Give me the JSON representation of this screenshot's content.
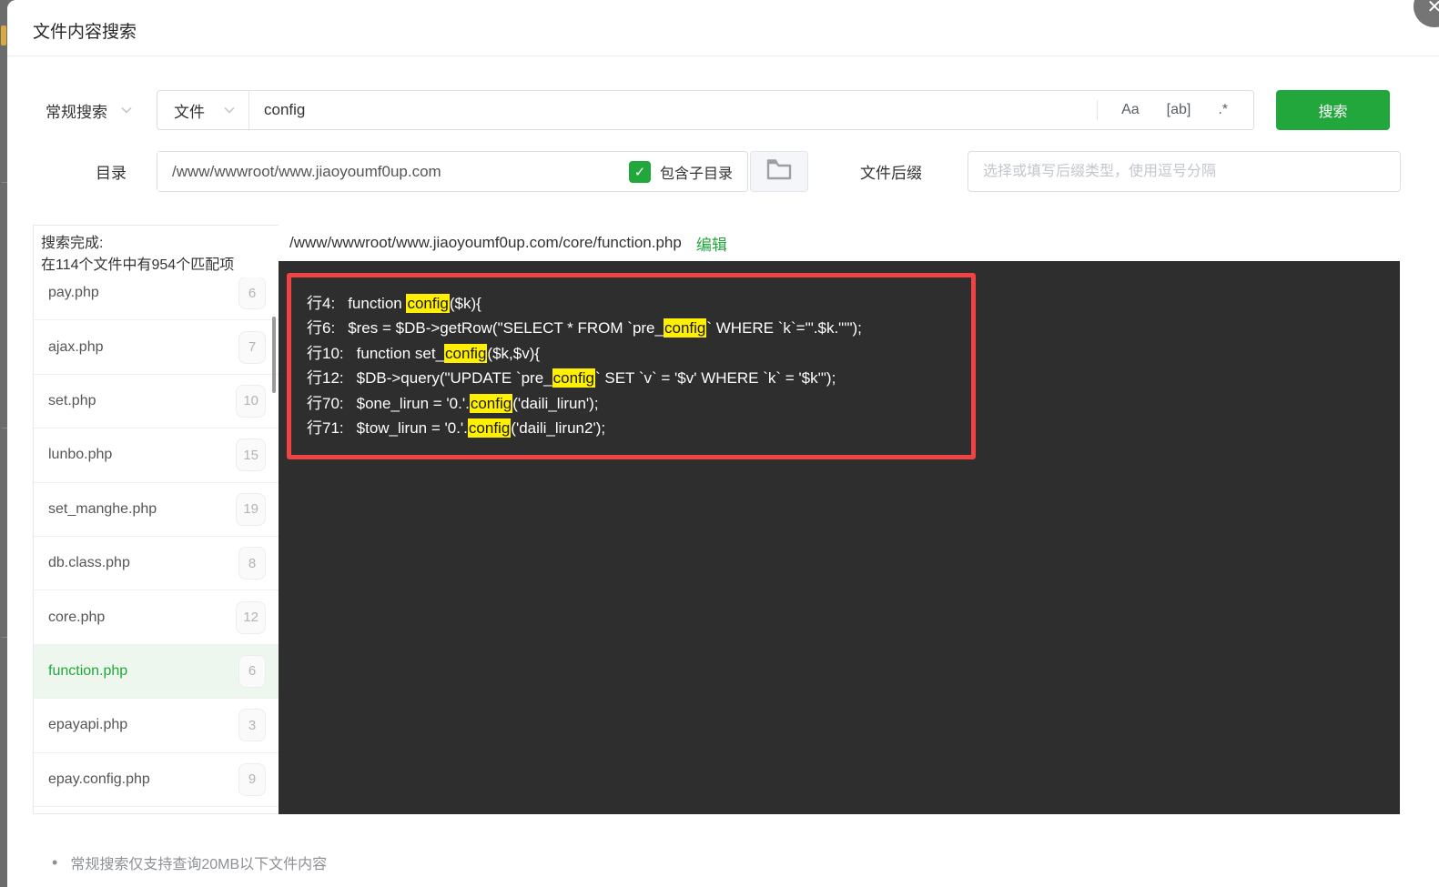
{
  "title": "文件内容搜索",
  "icons": {
    "close": "✕",
    "check": "✓",
    "bullet": "•",
    "chevron": "chevron-down",
    "folder": "folder-outline"
  },
  "colors": {
    "green": "#21a73c",
    "highlight_yellow": "#ffef00",
    "annotation_red": "#f04343",
    "code_bg": "#2e2e2e"
  },
  "search_bar": {
    "mode_select": "常规搜索",
    "type_select": "文件",
    "keyword": "config",
    "case_option": "Aa",
    "word_option": "[ab]",
    "regex_option": ".*",
    "search_button": "搜索"
  },
  "path_bar": {
    "dir_label": "目录",
    "dir_value": "/www/wwwroot/www.jiaoyoumf0up.com",
    "include_sub_label": "包含子目录",
    "suffix_label": "文件后缀",
    "suffix_placeholder": "选择或填写后缀类型，使用逗号分隔"
  },
  "results": {
    "summary_line1": "搜索完成:",
    "summary_line2": "在114个文件中有954个匹配项",
    "files": [
      {
        "name": "pay.php",
        "count": "6",
        "active": false
      },
      {
        "name": "ajax.php",
        "count": "7",
        "active": false
      },
      {
        "name": "set.php",
        "count": "10",
        "active": false
      },
      {
        "name": "lunbo.php",
        "count": "15",
        "active": false
      },
      {
        "name": "set_manghe.php",
        "count": "19",
        "active": false
      },
      {
        "name": "db.class.php",
        "count": "8",
        "active": false
      },
      {
        "name": "core.php",
        "count": "12",
        "active": false
      },
      {
        "name": "function.php",
        "count": "6",
        "active": true
      },
      {
        "name": "epayapi.php",
        "count": "3",
        "active": false
      },
      {
        "name": "epay.config.php",
        "count": "9",
        "active": false
      }
    ]
  },
  "viewer": {
    "path": "/www/wwwroot/www.jiaoyoumf0up.com/core/function.php",
    "edit_link": "编辑",
    "lines": [
      {
        "num": "行4:",
        "parts": [
          {
            "t": "function ",
            "h": false
          },
          {
            "t": "config",
            "h": true
          },
          {
            "t": "($k){",
            "h": false
          }
        ]
      },
      {
        "num": "行6:",
        "parts": [
          {
            "t": "$res = $DB->getRow(\"SELECT * FROM `pre_",
            "h": false
          },
          {
            "t": "config",
            "h": true
          },
          {
            "t": "` WHERE `k`='\".$k.\"'\");",
            "h": false
          }
        ]
      },
      {
        "num": "行10:",
        "parts": [
          {
            "t": "function set_",
            "h": false
          },
          {
            "t": "config",
            "h": true
          },
          {
            "t": "($k,$v){",
            "h": false
          }
        ]
      },
      {
        "num": "行12:",
        "parts": [
          {
            "t": "$DB->query(\"UPDATE `pre_",
            "h": false
          },
          {
            "t": "config",
            "h": true
          },
          {
            "t": "` SET `v` = '$v' WHERE `k` = '$k'\");",
            "h": false
          }
        ]
      },
      {
        "num": "行70:",
        "parts": [
          {
            "t": "$one_lirun = '0.'.",
            "h": false
          },
          {
            "t": "config",
            "h": true
          },
          {
            "t": "('daili_lirun');",
            "h": false
          }
        ]
      },
      {
        "num": "行71:",
        "parts": [
          {
            "t": "$tow_lirun = '0.'.",
            "h": false
          },
          {
            "t": "config",
            "h": true
          },
          {
            "t": "('daili_lirun2');",
            "h": false
          }
        ]
      }
    ]
  },
  "footer_note": "常规搜索仅支持查询20MB以下文件内容"
}
